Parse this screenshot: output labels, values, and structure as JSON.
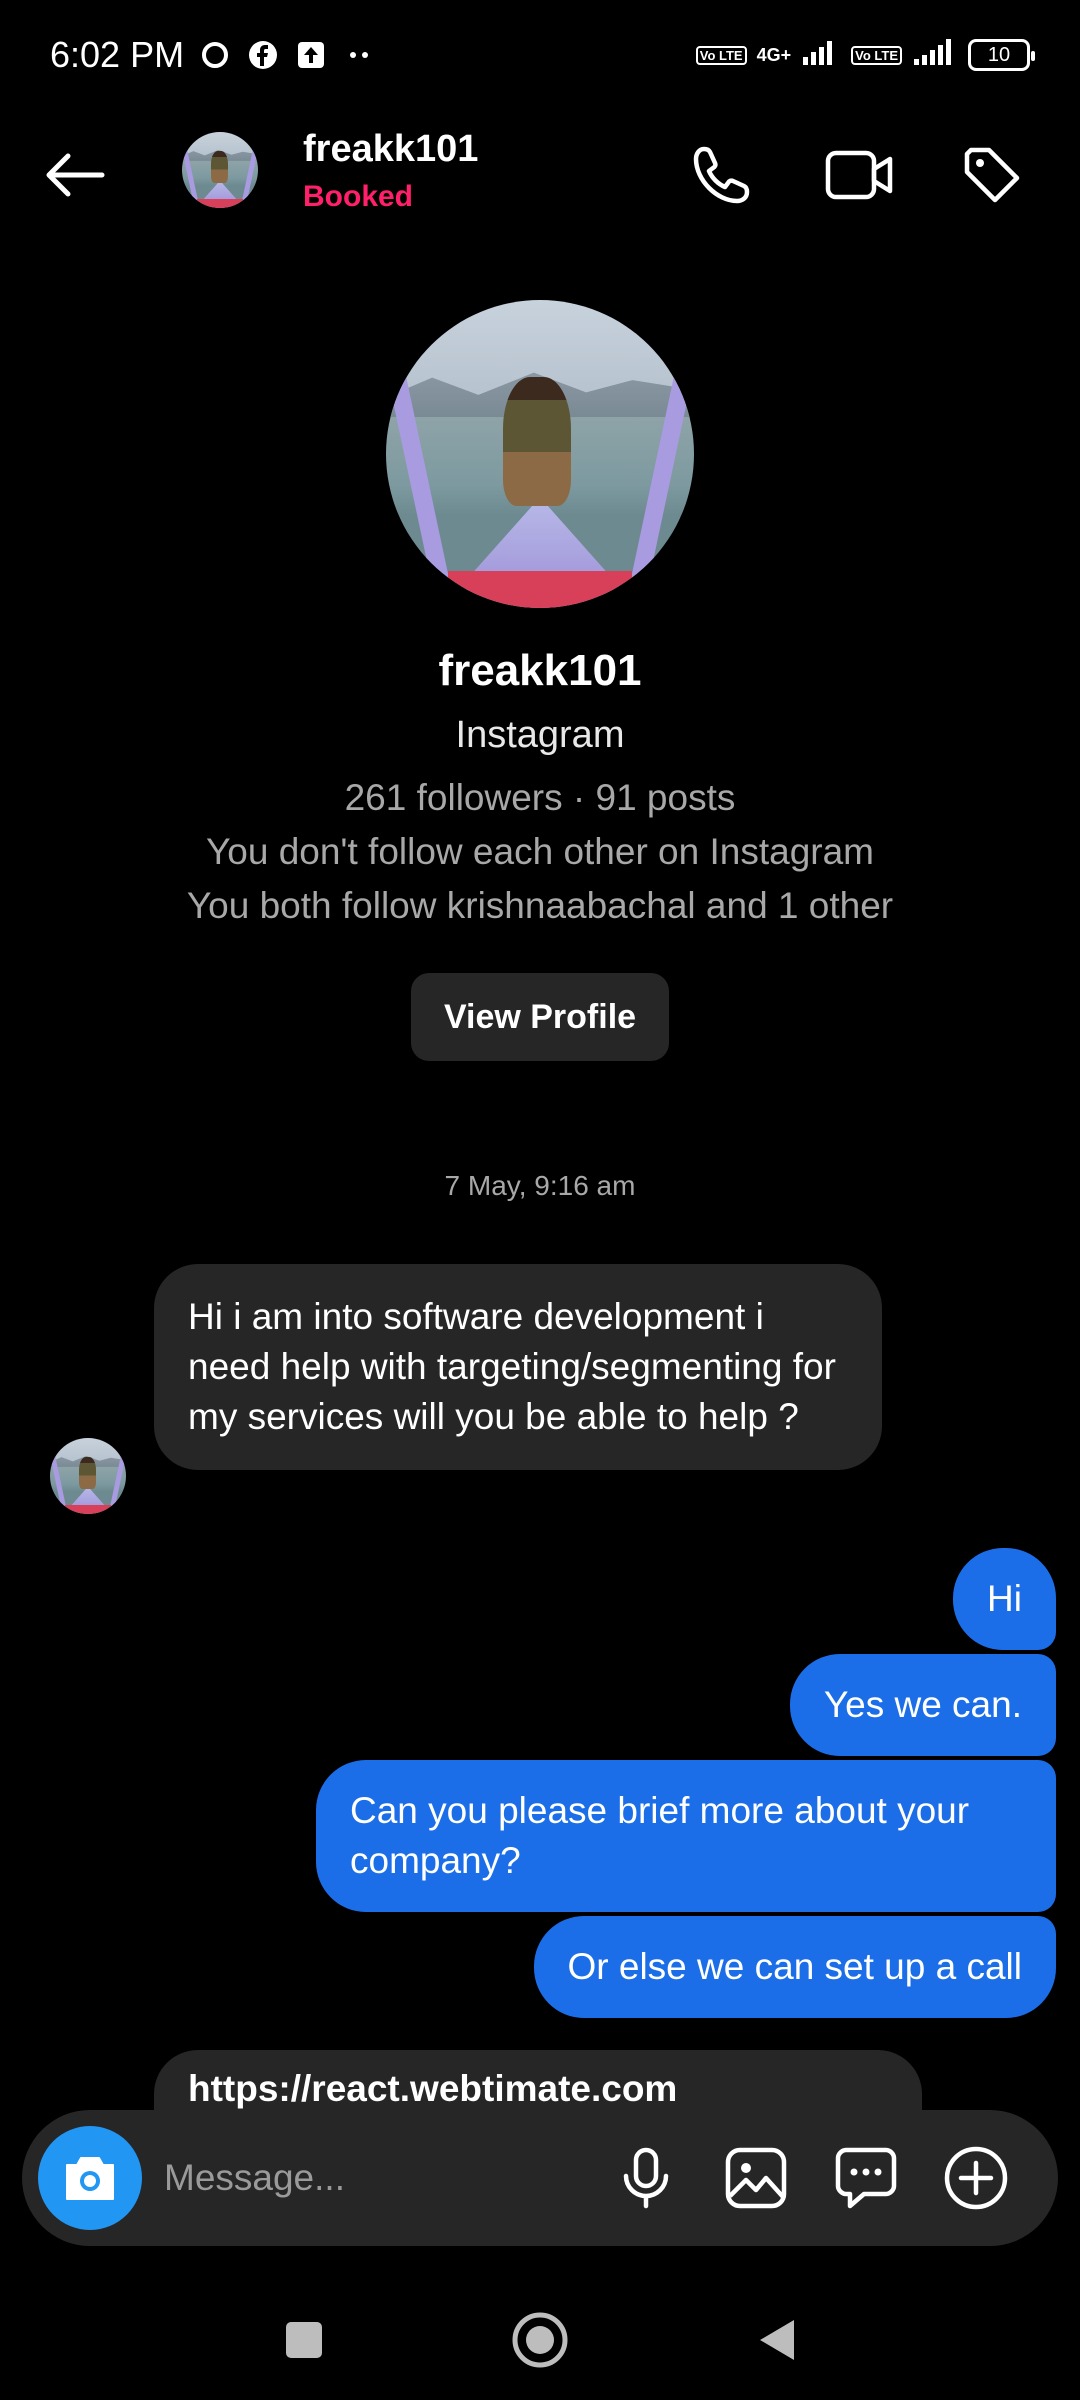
{
  "status_bar": {
    "time": "6:02 PM",
    "network": "4G+",
    "lte1": "Vo LTE",
    "lte2": "Vo LTE",
    "battery": "10",
    "icons": [
      "circle-icon",
      "facebook-icon",
      "upload-icon",
      "more-dots-icon",
      "signal-icon",
      "battery-icon"
    ]
  },
  "header": {
    "username": "freakk101",
    "status": "Booked",
    "icons": [
      "back-arrow-icon",
      "phone-icon",
      "video-call-icon",
      "tag-icon"
    ]
  },
  "profile": {
    "name": "freakk101",
    "platform": "Instagram",
    "stats": "261 followers · 91 posts",
    "follow_note": "You don't follow each other on Instagram",
    "mutual": "You both follow krishnaabachal and 1 other",
    "view_button": "View Profile"
  },
  "conversation": {
    "timestamp": "7 May, 9:16 am",
    "messages": [
      {
        "from": "them",
        "text": "Hi i am into software development i need help with targeting/segmenting for my services will you be able to help ?"
      },
      {
        "from": "me",
        "text": "Hi"
      },
      {
        "from": "me",
        "text": "Yes we can."
      },
      {
        "from": "me",
        "text": "Can you please brief more about your company?"
      },
      {
        "from": "me",
        "text": "Or else we can set up a call"
      },
      {
        "from": "them",
        "text": "https://react.webtimate.com"
      }
    ]
  },
  "composer": {
    "placeholder": "Message...",
    "icons": [
      "camera-icon",
      "microphone-icon",
      "gallery-icon",
      "sticker-chat-icon",
      "add-icon"
    ]
  },
  "colors": {
    "background": "#000000",
    "incoming_bubble": "#262626",
    "outgoing_bubble": "#1c6ee8",
    "status_pink": "#ff1f6b",
    "camera_blue": "#2196f3"
  }
}
